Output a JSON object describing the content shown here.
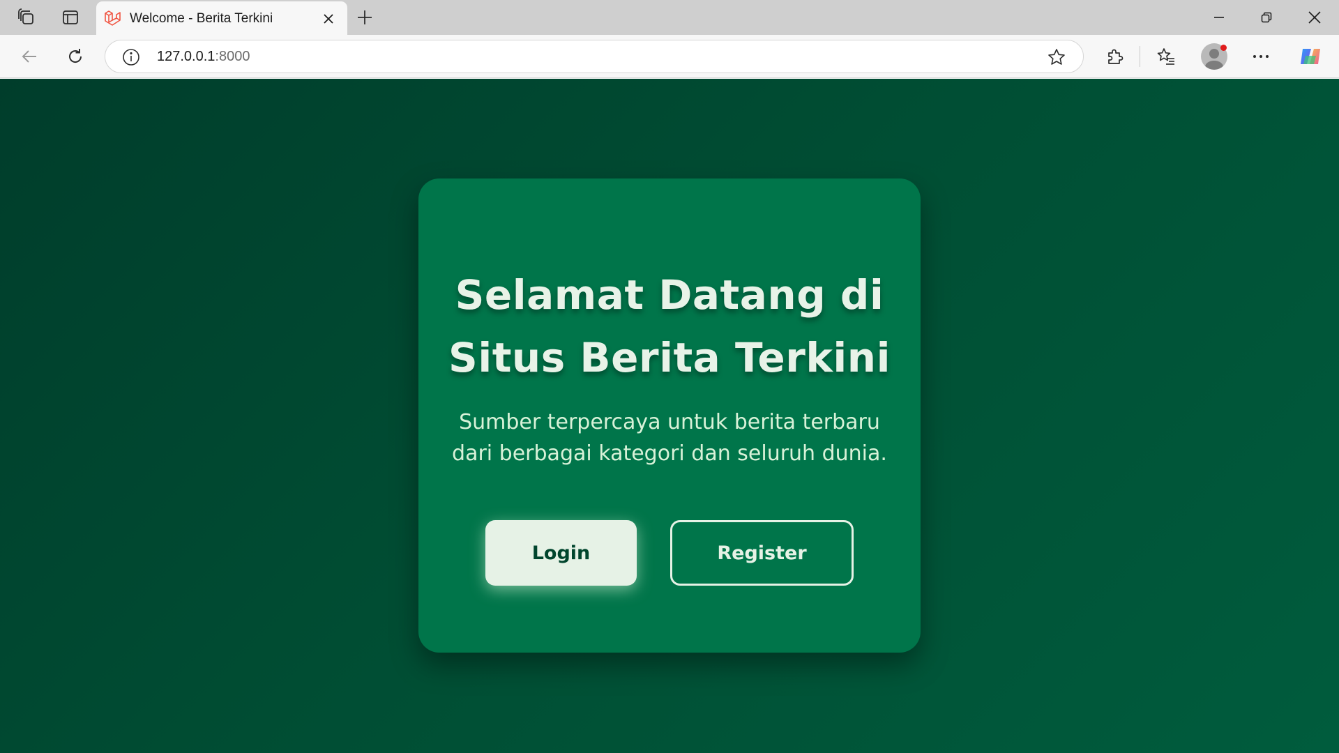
{
  "browser": {
    "tab": {
      "title": "Welcome - Berita Terkini",
      "favicon": "laravel-icon"
    },
    "address": {
      "host": "127.0.0.1",
      "port": ":8000"
    },
    "icons": {
      "workspaces": "workspaces-icon",
      "tab_actions": "tab-actions-icon",
      "close_tab": "close-icon",
      "new_tab": "plus-icon",
      "minimize": "minimize-icon",
      "restore": "restore-icon",
      "close_window": "close-icon",
      "back": "back-arrow-icon",
      "refresh": "refresh-icon",
      "site_info": "info-icon",
      "favorite": "star-icon",
      "extensions": "puzzle-icon",
      "favorites": "favorites-list-icon",
      "profile": "avatar-icon",
      "more": "more-icon",
      "copilot": "copilot-icon"
    }
  },
  "page": {
    "title": "Selamat Datang di Situs Berita Terkini",
    "subtitle": "Sumber terpercaya untuk berita terbaru dari berbagai kategori dan seluruh dunia.",
    "login_label": "Login",
    "register_label": "Register"
  },
  "colors": {
    "background": "#004d33",
    "card": "#00754a",
    "text_light": "#e8f3e8",
    "button_dark_text": "#00452d"
  }
}
